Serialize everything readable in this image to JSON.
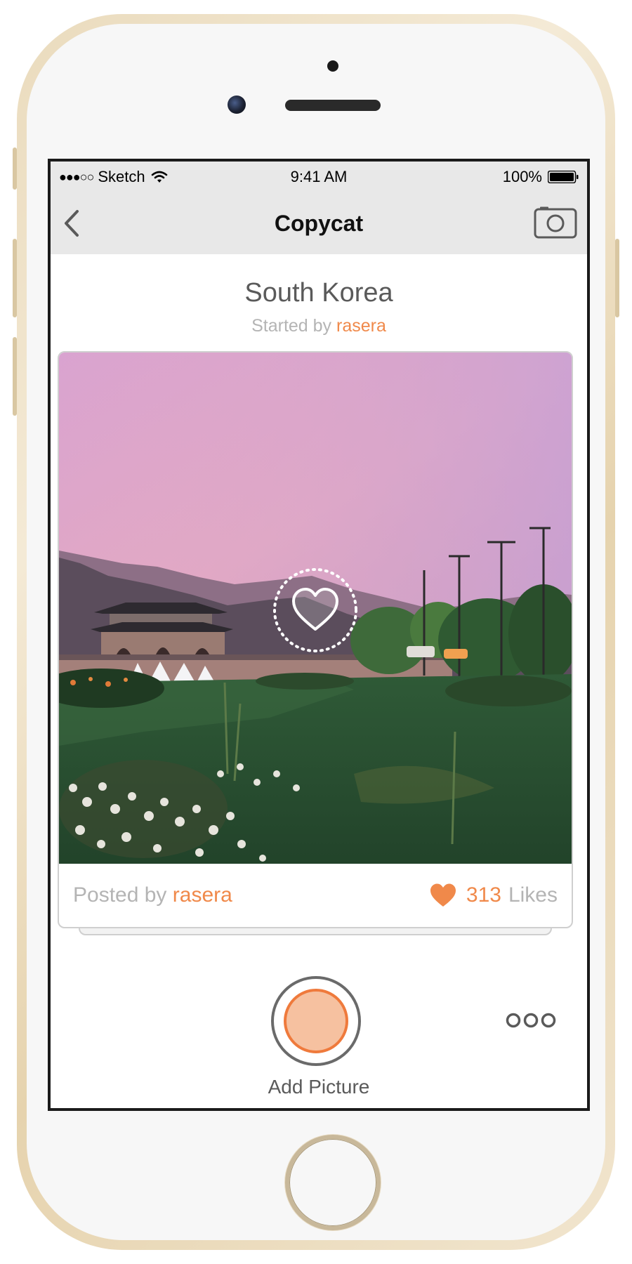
{
  "status_bar": {
    "signal": "●●●○○",
    "carrier": "Sketch",
    "time": "9:41 AM",
    "battery": "100%"
  },
  "nav": {
    "title": "Copycat",
    "back_icon": "chevron-left-icon",
    "camera_icon": "camera-icon"
  },
  "challenge": {
    "title": "South Korea",
    "started_by_label": "Started by",
    "started_by_user": "rasera"
  },
  "post": {
    "image_description_icon": "photo-palace-sunset",
    "posted_by_label": "Posted by",
    "posted_by_user": "rasera",
    "likes_count": "313",
    "likes_label": "Likes"
  },
  "actions": {
    "add_picture_label": "Add Picture",
    "more_icon": "more-dots-icon"
  },
  "colors": {
    "accent": "#f0894a",
    "nav_background": "#e8e8e8",
    "muted_text": "#b4b4b4",
    "title_text": "#5a5a5a"
  }
}
